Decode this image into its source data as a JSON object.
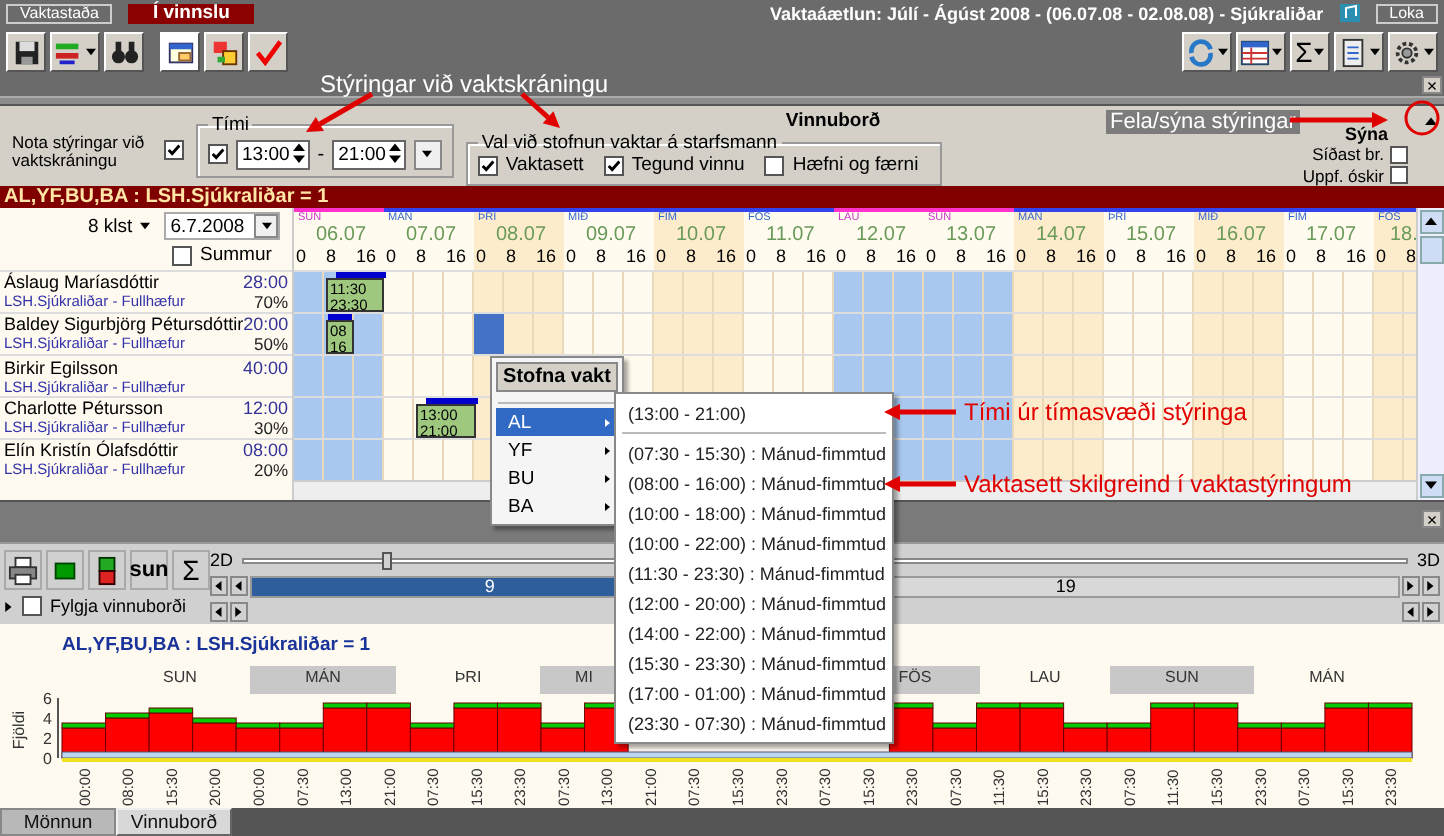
{
  "title_bar": {
    "status_button": "Vaktastaða",
    "state_label": "Í vinnslu",
    "title": "Vaktaáætlun: Júlí - Ágúst 2008 - (06.07.08 - 02.08.08) - Sjúkraliðar",
    "close_button": "Loka"
  },
  "toolbar": {
    "left_tools": [
      {
        "kind": "save",
        "pressed": false,
        "dropdown": false
      },
      {
        "kind": "layout",
        "pressed": false,
        "dropdown": true
      },
      {
        "kind": "search",
        "pressed": false,
        "dropdown": false
      },
      {
        "kind": "panel",
        "pressed": true,
        "dropdown": false
      },
      {
        "kind": "swap",
        "pressed": false,
        "dropdown": false
      },
      {
        "kind": "check",
        "pressed": false,
        "dropdown": false
      }
    ],
    "right_tools": [
      {
        "kind": "refresh",
        "dropdown": true
      },
      {
        "kind": "grid",
        "dropdown": true
      },
      {
        "kind": "text",
        "label": "Σ",
        "dropdown": true
      },
      {
        "kind": "document",
        "dropdown": true
      },
      {
        "kind": "gear",
        "dropdown": true
      }
    ],
    "close_button": "×"
  },
  "annotations": [
    "Stýringar við vaktskráningu",
    "Fela/sýna stýringar",
    "Tími úr tímasvæði stýringa",
    "Vaktasett skilgreind í vaktastýringum"
  ],
  "controls": {
    "use_label": "Nota stýringar við vaktskráningu",
    "use_checked": true,
    "time": {
      "title": "Tími",
      "checked": true,
      "from": "13:00",
      "separator": "-",
      "to": "21:00"
    },
    "panel_title": "Vinnuborð",
    "options": {
      "title": "Val við stofnun vaktar á starfsmann",
      "items": [
        {
          "label": "Vaktasett",
          "checked": true
        },
        {
          "label": "Tegund vinnu",
          "checked": true
        },
        {
          "label": "Hæfni og færni",
          "checked": false
        }
      ]
    },
    "show": {
      "title": "Sýna",
      "items": [
        {
          "label": "Síðast br.",
          "checked": false
        },
        {
          "label": "Uppf. óskir",
          "checked": false
        }
      ]
    }
  },
  "filter_bar": "AL,YF,BU,BA : LSH.Sjúkraliðar = 1",
  "schedule": {
    "interval": "8 klst",
    "date": "6.7.2008",
    "sum": {
      "label": "Summur",
      "checked": false
    },
    "days": [
      {
        "name": "SUN",
        "date": "06.07",
        "kind": "weekend",
        "hours": [
          "0",
          "8",
          "16"
        ]
      },
      {
        "name": "MÁN",
        "date": "07.07",
        "kind": "light",
        "hours": [
          "0",
          "8",
          "16"
        ]
      },
      {
        "name": "ÞRI",
        "date": "08.07",
        "kind": "dark",
        "hours": [
          "0",
          "8",
          "16"
        ]
      },
      {
        "name": "MIÐ",
        "date": "09.07",
        "kind": "light",
        "hours": [
          "0",
          "8",
          "16"
        ]
      },
      {
        "name": "FIM",
        "date": "10.07",
        "kind": "dark",
        "hours": [
          "0",
          "8",
          "16"
        ]
      },
      {
        "name": "FÖS",
        "date": "11.07",
        "kind": "light",
        "hours": [
          "0",
          "8",
          "16"
        ]
      },
      {
        "name": "LAU",
        "date": "12.07",
        "kind": "weekend",
        "hours": [
          "0",
          "8",
          "16"
        ]
      },
      {
        "name": "SUN",
        "date": "13.07",
        "kind": "weekend",
        "hours": [
          "0",
          "8",
          "16"
        ]
      },
      {
        "name": "MÁN",
        "date": "14.07",
        "kind": "dark",
        "hours": [
          "0",
          "8",
          "16"
        ]
      },
      {
        "name": "ÞRI",
        "date": "15.07",
        "kind": "light",
        "hours": [
          "0",
          "8",
          "16"
        ]
      },
      {
        "name": "MIÐ",
        "date": "16.07",
        "kind": "dark",
        "hours": [
          "0",
          "8",
          "16"
        ]
      },
      {
        "name": "FIM",
        "date": "17.07",
        "kind": "light",
        "hours": [
          "0",
          "8",
          "16"
        ]
      },
      {
        "name": "FÖS",
        "date": "18.",
        "kind": "dark",
        "hours": [
          "0",
          "8"
        ]
      }
    ],
    "rows": [
      {
        "name": "Áslaug Maríasdóttir",
        "unit": "LSH.Sjúkraliðar - Fullhæfur",
        "hours": "28:00",
        "percent": "70%",
        "selected": false,
        "shifts": [
          {
            "start": "11:30",
            "end": "23:30"
          }
        ]
      },
      {
        "name": "Baldey Sigurbjörg Pétursdóttir",
        "unit": "LSH.Sjúkraliðar - Fullhæfur",
        "hours": "20:00",
        "percent": "50%",
        "selected": true,
        "shifts": [
          {
            "start": "08",
            "end": "16"
          }
        ]
      },
      {
        "name": "Birkir Egilsson",
        "unit": "LSH.Sjúkraliðar - Fullhæfur",
        "hours": "40:00",
        "selected": false,
        "shifts": []
      },
      {
        "name": "Charlotte Pétursson",
        "unit": "LSH.Sjúkraliðar - Fullhæfur",
        "hours": "12:00",
        "percent": "30%",
        "selected": false,
        "shifts": [
          {
            "start": "13:00",
            "end": "21:00"
          }
        ]
      },
      {
        "name": "Elín Kristín Ólafsdóttir",
        "unit": "LSH.Sjúkraliðar - Fullhæfur",
        "hours": "08:00",
        "percent": "20%",
        "selected": false,
        "shifts": []
      }
    ]
  },
  "context_menu": {
    "title": "Stofna vakt",
    "items": [
      {
        "label": "AL",
        "selected": true
      },
      {
        "label": "YF",
        "selected": false
      },
      {
        "label": "BU",
        "selected": false
      },
      {
        "label": "BA",
        "selected": false
      }
    ]
  },
  "submenu": {
    "current": "(13:00 - 21:00)",
    "items": [
      "(07:30 - 15:30) : Mánud-fimmtud",
      "(08:00 - 16:00) : Mánud-fimmtud",
      "(10:00 - 18:00) : Mánud-fimmtud",
      "(10:00 - 22:00) : Mánud-fimmtud",
      "(11:30 - 23:30) : Mánud-fimmtud",
      "(12:00 - 20:00) : Mánud-fimmtud",
      "(14:00 - 22:00) : Mánud-fimmtud",
      "(15:30 - 23:30) : Mánud-fimmtud",
      "(17:00 - 01:00) : Mánud-fimmtud",
      "(23:30 - 07:30) : Mánud-fimmtud"
    ]
  },
  "dock_close": "×",
  "bottom_toolbar": {
    "sun_button": "sun",
    "sum_button": "Σ",
    "follow": {
      "label": "Fylgja vinnuborði",
      "checked": false
    },
    "view_min": "2D",
    "view_max": "3D",
    "view_slider": {
      "level": 0.12
    },
    "timeline": {
      "level": 0.42,
      "start_label": "9",
      "end_label": "19"
    }
  },
  "chart": {
    "title": "AL,YF,BU,BA : LSH.Sjúkraliðar = 1",
    "day_bands": [
      {
        "label": "SUN",
        "shaded": false
      },
      {
        "label": "MÁN",
        "shaded": true
      },
      {
        "label": "ÞRI",
        "shaded": false
      },
      {
        "label": "MI",
        "shaded": true
      },
      {
        "label": "FÖS",
        "shaded": true
      },
      {
        "label": "LAU",
        "shaded": false
      },
      {
        "label": "SUN",
        "shaded": true
      },
      {
        "label": "MÁN",
        "shaded": false
      }
    ],
    "chart_data": {
      "type": "bar",
      "ylabel": "Fjöldi",
      "stacked": true,
      "ylim": [
        0,
        6
      ],
      "yticks": [
        0,
        2,
        4,
        6
      ],
      "categories": [
        "00:00",
        "08:00",
        "15:30",
        "20:00",
        "00:00",
        "07:30",
        "13:00",
        "21:00",
        "07:30",
        "15:30",
        "23:30",
        "07:30",
        "13:00",
        "21:00",
        "07:30",
        "15:30",
        "23:30",
        "07:30",
        "15:30",
        "23:30",
        "07:30",
        "11:30",
        "15:30",
        "23:30",
        "07:30",
        "11:30",
        "15:30",
        "23:30",
        "07:30",
        "15:30",
        "23:30"
      ],
      "series": [
        {
          "color": "#ff0000",
          "values": [
            3,
            4,
            4.5,
            3.5,
            3,
            3,
            5,
            5,
            3,
            5,
            5,
            3,
            5,
            null,
            null,
            null,
            null,
            null,
            null,
            5,
            3,
            5,
            5,
            3,
            3,
            5,
            5,
            3,
            3,
            5,
            5
          ]
        },
        {
          "color": "#00cc00",
          "values": [
            0.5,
            0.5,
            0.5,
            0.5,
            0.5,
            0.5,
            0.5,
            0.5,
            0.5,
            0.5,
            0.5,
            0.5,
            0.5,
            null,
            null,
            null,
            null,
            null,
            null,
            0.5,
            0.5,
            0.5,
            0.5,
            0.5,
            0.5,
            0.5,
            0.5,
            0.5,
            0.5,
            0.5,
            0.5
          ]
        }
      ]
    }
  },
  "tabs": [
    {
      "label": "Mönnun",
      "selected": false
    },
    {
      "label": "Vinnuborð",
      "selected": true
    }
  ]
}
